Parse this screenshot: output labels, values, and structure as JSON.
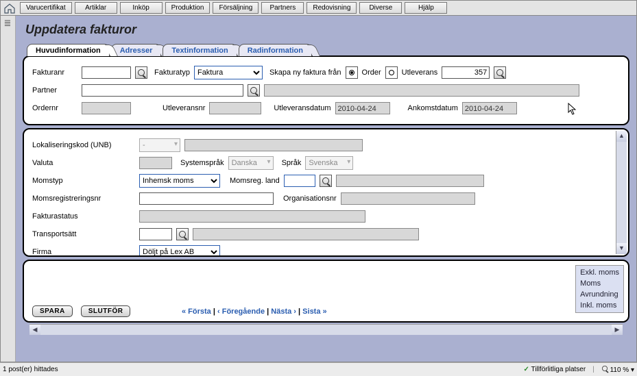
{
  "menu": [
    "Varucertifikat",
    "Artiklar",
    "Inköp",
    "Produktion",
    "Försäljning",
    "Partners",
    "Redovisning",
    "Diverse",
    "Hjälp"
  ],
  "page_title": "Uppdatera fakturor",
  "tabs": [
    "Huvudinformation",
    "Adresser",
    "Textinformation",
    "Radinformation"
  ],
  "head": {
    "fakturanr_label": "Fakturanr",
    "fakturanr_value": "",
    "fakturatyp_label": "Fakturatyp",
    "fakturatyp_value": "Faktura",
    "skapa_label": "Skapa ny faktura från",
    "order_label": "Order",
    "utleverans_label": "Utleverans",
    "skapa_source_selected": "order",
    "source_ref": "357",
    "partner_label": "Partner",
    "partner_value": "",
    "ordernr_label": "Ordernr",
    "ordernr_value": "",
    "utleveransnr_label": "Utleveransnr",
    "utleveransnr_value": "",
    "utleveransdatum_label": "Utleveransdatum",
    "utleveransdatum_value": "2010-04-24",
    "ankomstdatum_label": "Ankomstdatum",
    "ankomstdatum_value": "2010-04-24"
  },
  "details": {
    "lokaliseringskod_label": "Lokaliseringskod (UNB)",
    "lokaliseringskod_value": "-",
    "valuta_label": "Valuta",
    "systemsprak_label": "Systemspråk",
    "systemsprak_value": "Danska",
    "sprak_label": "Språk",
    "sprak_value": "Svenska",
    "momstyp_label": "Momstyp",
    "momstyp_value": "Inhemsk moms",
    "momsreg_land_label": "Momsreg. land",
    "momsreg_land_value": "",
    "momsregistreringsnr_label": "Momsregistreringsnr",
    "momsregistreringsnr_value": "",
    "organisationsnr_label": "Organisationsnr",
    "organisationsnr_value": "",
    "fakturastatus_label": "Fakturastatus",
    "transportsatt_label": "Transportsätt",
    "transportsatt_value": "",
    "firma_label": "Firma",
    "firma_value": "Döljt på Lex AB"
  },
  "footer": {
    "save": "SPARA",
    "finish": "SLUTFÖR",
    "pager_first": "« Första",
    "pager_prev": "‹ Föregående",
    "pager_next": "Nästa ›",
    "pager_last": "Sista »",
    "totals": [
      "Exkl. moms",
      "Moms",
      "Avrundning",
      "Inkl. moms"
    ]
  },
  "status": {
    "left": "1 post(er) hittades",
    "trust": "Tillförlitliga platser",
    "zoom": "110 %"
  }
}
